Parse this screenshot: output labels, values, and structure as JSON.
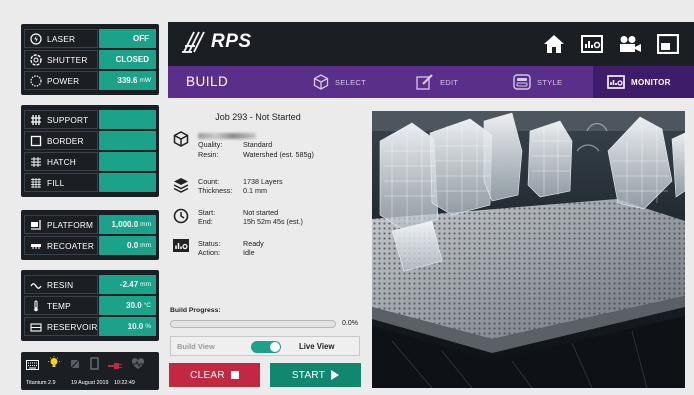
{
  "status_panels": {
    "hardware": [
      {
        "name": "laser",
        "label": "LASER",
        "value": "OFF",
        "unit": ""
      },
      {
        "name": "shutter",
        "label": "SHUTTER",
        "value": "CLOSED",
        "unit": ""
      },
      {
        "name": "power",
        "label": "POWER",
        "value": "339.6",
        "unit": "mW"
      }
    ],
    "geometry": [
      {
        "name": "support",
        "label": "SUPPORT",
        "value": "",
        "unit": ""
      },
      {
        "name": "border",
        "label": "BORDER",
        "value": "",
        "unit": ""
      },
      {
        "name": "hatch",
        "label": "HATCH",
        "value": "",
        "unit": ""
      },
      {
        "name": "fill",
        "label": "FILL",
        "value": "",
        "unit": ""
      }
    ],
    "motion": [
      {
        "name": "platform",
        "label": "PLATFORM",
        "value": "1,000.0",
        "unit": "mm"
      },
      {
        "name": "recoater",
        "label": "RECOATER",
        "value": "0.0",
        "unit": "mm"
      }
    ],
    "environment": [
      {
        "name": "resin",
        "label": "RESIN",
        "value": "-2.47",
        "unit": "mm"
      },
      {
        "name": "temp",
        "label": "TEMP",
        "value": "30.0",
        "unit": "°C"
      },
      {
        "name": "reservoir",
        "label": "RESERVOIR",
        "value": "10.0",
        "unit": "%"
      }
    ]
  },
  "footer": {
    "version": "Titanium 2.9",
    "date": "19 August 2019",
    "time": "10:22:49"
  },
  "header": {
    "logo_text": "RPS"
  },
  "nav": {
    "title": "BUILD",
    "tabs": [
      {
        "name": "select",
        "label": "SELECT",
        "active": false
      },
      {
        "name": "edit",
        "label": "EDIT",
        "active": false
      },
      {
        "name": "style",
        "label": "STYLE",
        "active": false
      },
      {
        "name": "monitor",
        "label": "MONITOR",
        "active": true
      }
    ]
  },
  "job": {
    "title": "Job 293 - Not Started",
    "quality_label": "Quality:",
    "quality": "Standard",
    "resin_label": "Resin:",
    "resin": "Watershed (est. 585g)",
    "count_label": "Count:",
    "count": "1738 Layers",
    "thickness_label": "Thickness:",
    "thickness": "0.1 mm",
    "start_label": "Start:",
    "start": "Not started",
    "end_label": "End:",
    "end": "15h 52m 45s  (est.)",
    "status_label": "Status:",
    "status": "Ready",
    "action_label": "Action:",
    "action": "Idle"
  },
  "progress": {
    "label": "Build Progress:",
    "percent_text": "0.0%",
    "value": 0
  },
  "view_toggle": {
    "left_label": "Build View",
    "right_label": "Live View",
    "on": true
  },
  "buttons": {
    "clear": "CLEAR",
    "start": "START"
  },
  "colors": {
    "accent": "#1aa38a",
    "nav": "#5a2f8a",
    "nav_active": "#3f1c6a",
    "panel": "#1b1f24",
    "clear": "#c22840",
    "start": "#12876f"
  }
}
